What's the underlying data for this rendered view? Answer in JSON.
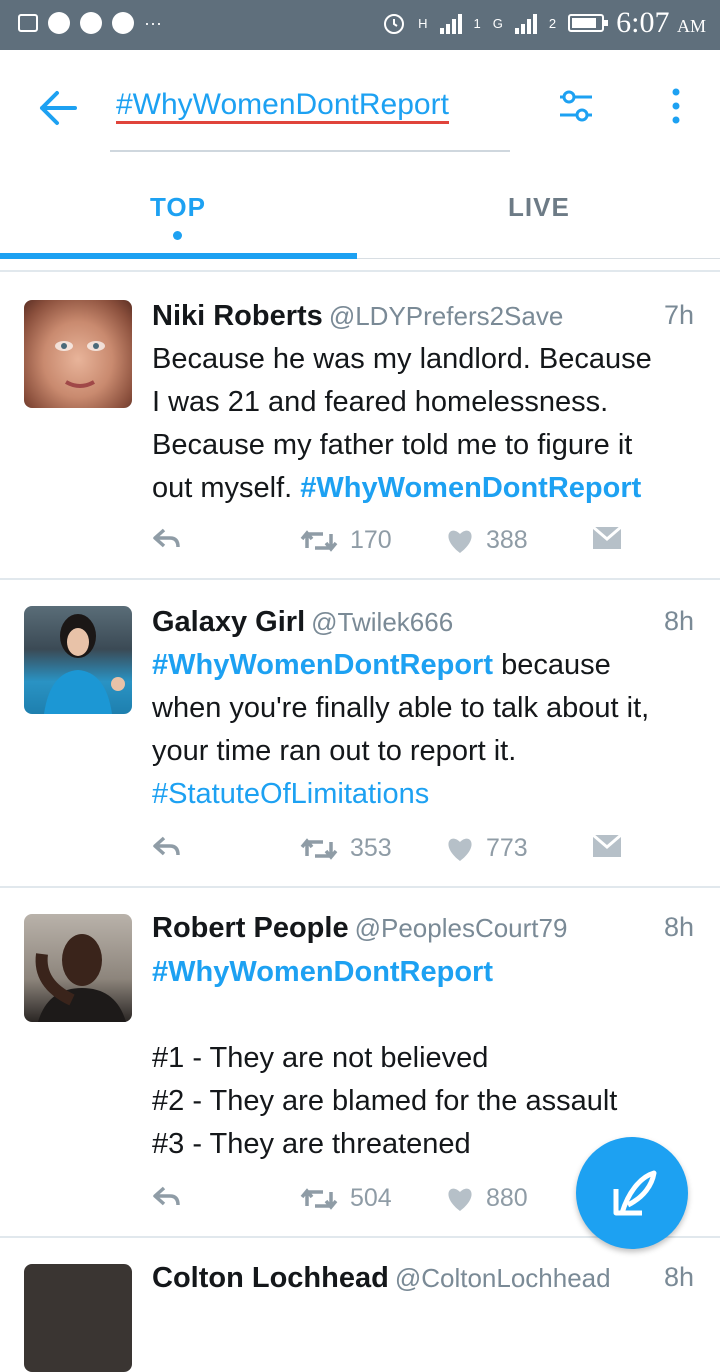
{
  "status_bar": {
    "time": "6:07",
    "ampm": "AM",
    "network_1": "H",
    "network_2": "H",
    "network_3": "G",
    "sim_1": "1",
    "sim_2": "2",
    "battery_level": 0.85,
    "more_icons": "···"
  },
  "header": {
    "search_query": "#WhyWomenDontReport"
  },
  "tabs": [
    {
      "label": "TOP",
      "active": true
    },
    {
      "label": "LIVE",
      "active": false
    }
  ],
  "tweets": [
    {
      "name": "Niki Roberts",
      "handle": "@LDYPrefers2Save",
      "time": "7h",
      "lines": [
        "Because he was my landlord. Because",
        "I was 21 and feared homelessness.",
        "Because my father told me to figure it",
        "out myself. "
      ],
      "hashtag": "#WhyWomenDontReport",
      "retweets": "170",
      "likes": "388"
    },
    {
      "name": "Galaxy Girl",
      "handle": "@Twilek666",
      "time": "8h",
      "hashtag": "#WhyWomenDontReport",
      "line1_rest": " because",
      "lines": [
        "when you're finally able to talk about it,",
        "your time ran out to report it."
      ],
      "hashtag2": "#StatuteOfLimitations",
      "retweets": "353",
      "likes": "773"
    },
    {
      "name": "Robert People",
      "handle": "@PeoplesCourt79",
      "time": "8h",
      "hashtag": "#WhyWomenDontReport",
      "lines": [
        "#1 - They are not believed",
        "#2 - They are blamed for the assault",
        "#3 - They are threatened"
      ],
      "retweets": "504",
      "likes": "880"
    },
    {
      "name": "Colton Lochhead",
      "handle": "@ColtonLochhead",
      "time": "8h"
    }
  ]
}
